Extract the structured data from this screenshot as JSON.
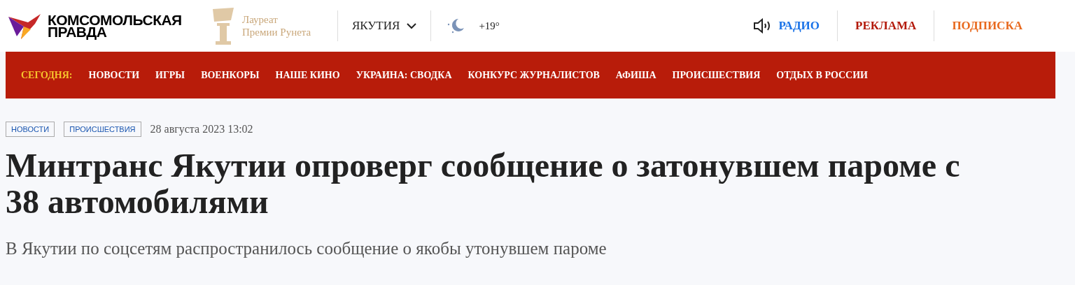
{
  "logo": {
    "line_1": "КОМСОМОЛЬСКАЯ",
    "line_2": "ПРАВДА"
  },
  "award": {
    "line_1": "Лауреат",
    "line_2": "Премии Рунета"
  },
  "region": {
    "label": "ЯКУТИЯ"
  },
  "weather": {
    "temperature": "+19°"
  },
  "top_links": [
    {
      "kind": "radio",
      "label": "РАДИО",
      "color": "#1a73e8"
    },
    {
      "kind": "plain",
      "label": "РЕКЛАМА",
      "color": "#b3190a"
    },
    {
      "kind": "plain",
      "label": "ПОДПИСКА",
      "color": "#e8691e"
    }
  ],
  "nav": {
    "today": "СЕГОДНЯ:",
    "items": [
      "НОВОСТИ",
      "ИГРЫ",
      "ВОЕНКОРЫ",
      "НАШЕ КИНО",
      "УКРАИНА: СВОДКА",
      "КОНКУРС ЖУРНАЛИСТОВ",
      "АФИША",
      "ПРОИСШЕСТВИЯ",
      "ОТДЫХ В РОССИИ"
    ]
  },
  "article": {
    "tags": [
      "НОВОСТИ",
      "ПРОИСШЕСТВИЯ"
    ],
    "date": "28 августа 2023 13:02",
    "title": "Минтранс Якутии опроверг сообщение о затонувшем пароме с 38 автомобилями",
    "lead": "В Якутии по соцсетям распространилось сообщение о якобы утонувшем пароме"
  }
}
